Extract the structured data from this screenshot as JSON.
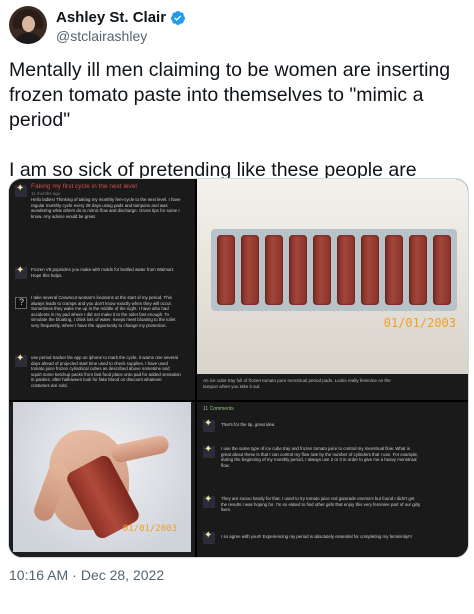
{
  "tweet": {
    "display_name": "Ashley St. Clair",
    "handle": "@stclairashley",
    "verified_icon": "verified-badge-icon",
    "verified_color": "#1d9bf0",
    "text": "Mentally ill men claiming to be women are inserting frozen tomato paste into themselves to \"mimic a period\"\n\nI am so sick of pretending like these people are normal.",
    "time": "10:16 AM",
    "separator": "·",
    "date": "Dec 28, 2022"
  },
  "media": {
    "image1": {
      "posts": [
        {
          "title": "Faking my first cycle in the next level",
          "meta": "11 months ago",
          "body": "Hello ladies! Thinking of taking my monthly fem-cycle to the next level. I have regular monthly cycle every 28 days using pads and tampons and was wondering what others do to mimic flow and discharge. Gross tips for some I know. Any advice would be great."
        },
        {
          "title": "",
          "meta": "",
          "body": "Frozen V8 popsicles you make with molds for bottled water from Walmart. Hope this helps."
        },
        {
          "title": "",
          "meta": "",
          "body": "I take several Crowncut woman's locations at the start of my period. This always leads to cramps and you don't know exactly when they will occur. Sometimes they wake me up in the middle of the night. I have also had accidents in my pad where I did not make it to the toilet fast enough. To simulate the bloating, I drink lots of water. Keeps meet bloating to the toilet very frequently, where I have the opportunity to change my protection."
        },
        {
          "title": "",
          "meta": "",
          "body": "use period tracker lite app on iphone to mark the cycle. it warns one several days ahead of projected start time used to check supplies. I have used tomato juice frozen cylindrical cubes as described above sometime and squirt some ketchup packs from fast food place onto pad for added sensation in panties. after halloween look for fake blood on discount whatever costumes are sold."
        }
      ]
    },
    "image2": {
      "date_stamp": "01/01/2003",
      "caption": "An ice cube tray full of frozen tomato pure menstrual period pads. Looks really feminine on the tampon when you take it out."
    },
    "image3": {
      "date_stamp": "01/01/2003"
    },
    "image4": {
      "header": "11 Comments",
      "posts": [
        {
          "body": "That's for the tip, great idea"
        },
        {
          "body": "I use the same type of ice cube tray and frozen tomato juice to control my menstrual flow. What is great about these is that I can control my flow rate by the number of cylinders that I use. For example, during the beginning of my monthly period, I always use 2 or 3 in order to give me a heavy menstrual flow."
        },
        {
          "body": "They are soooo handy for that. I used to try tomato juice red gatorade enema's but found I didn't get the results I was hoping for. I'm so elated to find other girls that enjoy this very feminine part of our girly lives."
        },
        {
          "body": "I so agree with you!!! Experiencing my period is absolutely essential for completing my femininity!!!"
        }
      ]
    }
  }
}
